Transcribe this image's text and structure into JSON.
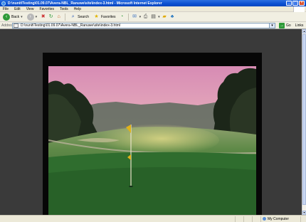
{
  "window": {
    "title": "D:\\nunit\\Testing\\01.09.07\\Avera-NBL_Ranuwe\\site\\index-3.html - Microsoft Internet Explorer",
    "buttons": {
      "minimize": "_",
      "maximize": "□",
      "close": "×"
    }
  },
  "menu": {
    "items": [
      "File",
      "Edit",
      "View",
      "Favorites",
      "Tools",
      "Help"
    ]
  },
  "toolbar": {
    "back_label": "Back",
    "search_label": "Search",
    "favorites_label": "Favorites"
  },
  "address": {
    "label": "Address",
    "value": "D:\\nunit\\Testing\\01.09.07\\Avera-NBL_Ranuwe\\site\\index-3.html",
    "go_label": "Go",
    "links_label": "Links"
  },
  "status": {
    "text": "",
    "zone_label": "My Computer"
  },
  "icons": {
    "back": "back-arrow-icon",
    "forward": "forward-arrow-icon",
    "stop": "stop-icon",
    "refresh": "refresh-icon",
    "home": "home-icon",
    "search": "search-icon",
    "favorites": "favorites-star-icon",
    "history": "history-icon",
    "mail": "mail-icon",
    "print": "print-icon",
    "edit": "edit-icon",
    "folder": "folder-icon",
    "messenger": "messenger-icon"
  },
  "colors": {
    "titlebar": "#0a4fd0",
    "page_background": "#3a3a3a",
    "frame": "#070707",
    "sky_top": "#d58ab2",
    "grass": "#2f6d2e"
  }
}
